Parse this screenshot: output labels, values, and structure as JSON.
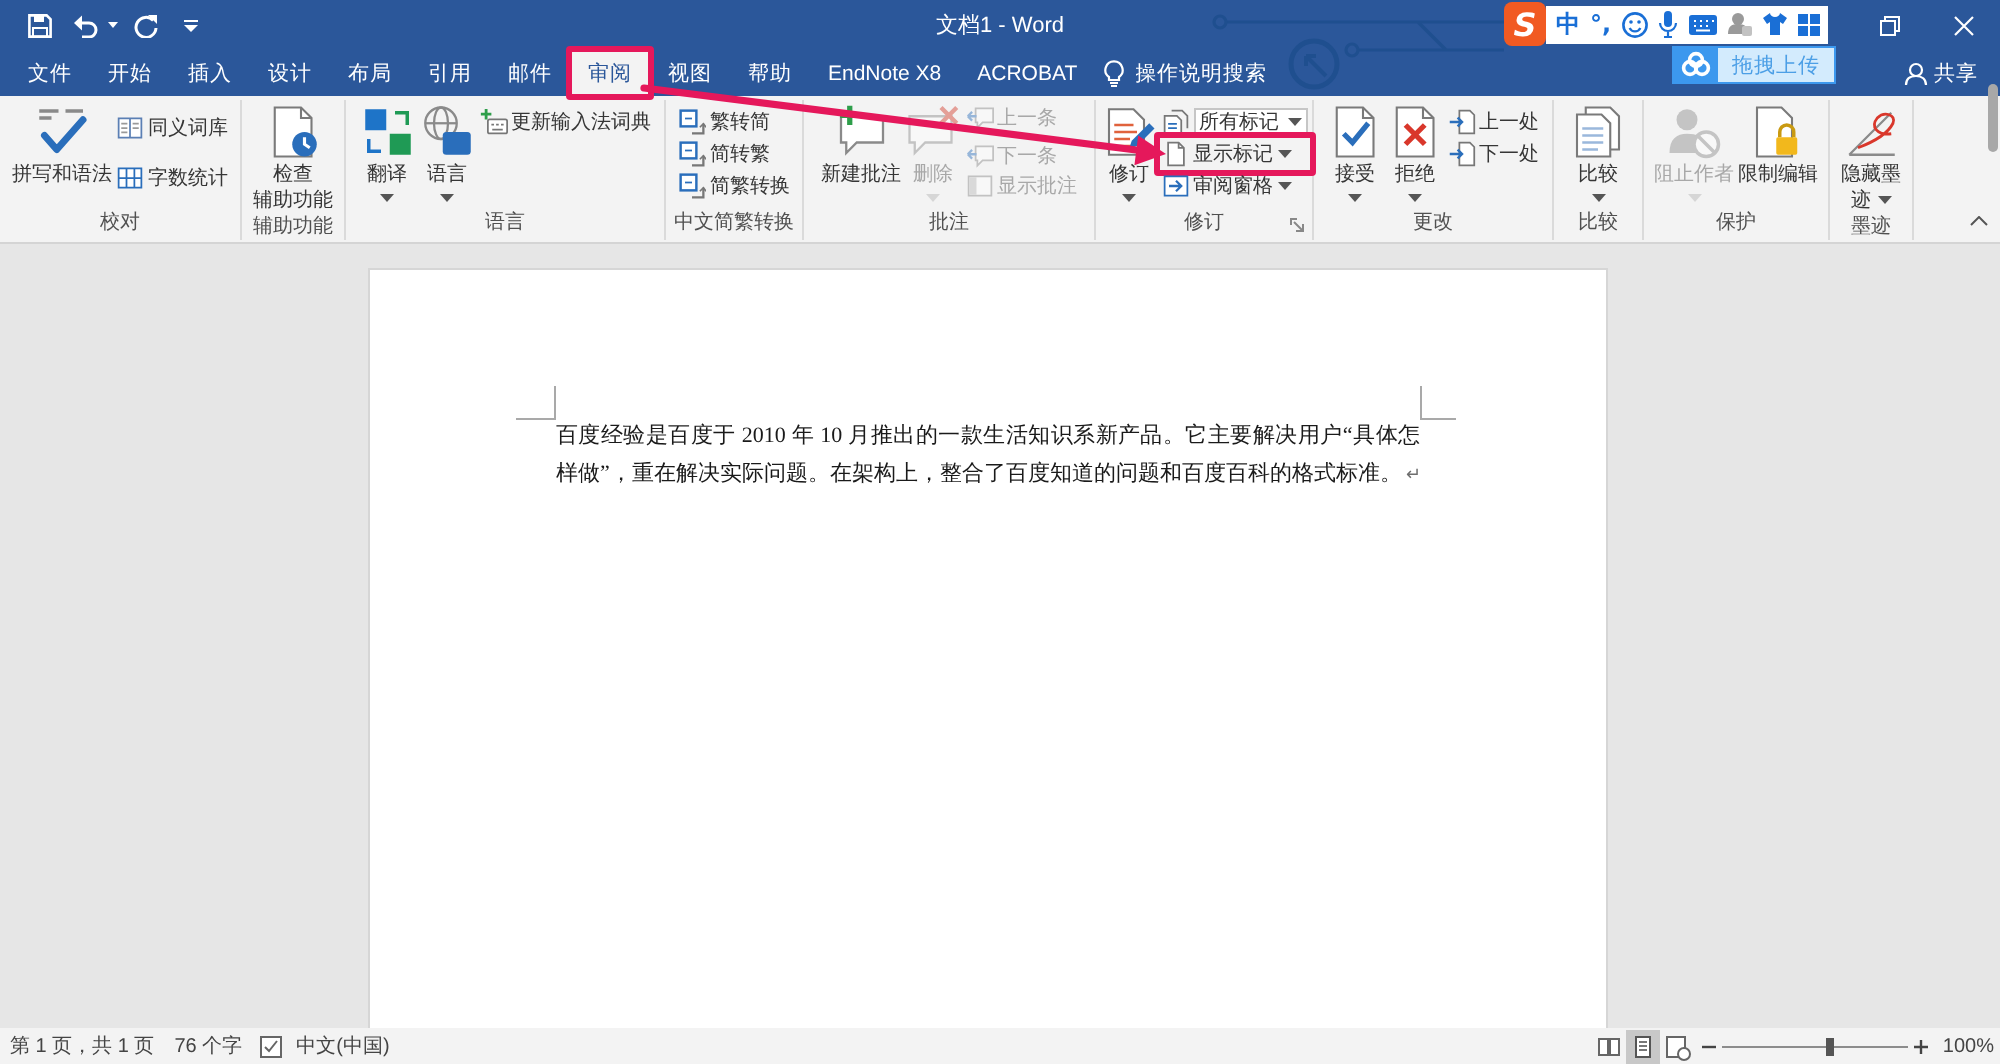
{
  "window": {
    "title": "文档1 - Word"
  },
  "ime_toolbar": {
    "logo": "S",
    "mode": "中",
    "punctuation": "°,"
  },
  "cloud_upload": {
    "label": "拖拽上传"
  },
  "tabs": [
    {
      "label": "文件",
      "selected": false,
      "highlighted": false
    },
    {
      "label": "开始",
      "selected": false,
      "highlighted": false
    },
    {
      "label": "插入",
      "selected": false,
      "highlighted": false
    },
    {
      "label": "设计",
      "selected": false,
      "highlighted": false
    },
    {
      "label": "布局",
      "selected": false,
      "highlighted": false
    },
    {
      "label": "引用",
      "selected": false,
      "highlighted": false
    },
    {
      "label": "邮件",
      "selected": false,
      "highlighted": false
    },
    {
      "label": "审阅",
      "selected": true,
      "highlighted": true
    },
    {
      "label": "视图",
      "selected": false,
      "highlighted": false
    },
    {
      "label": "帮助",
      "selected": false,
      "highlighted": false
    },
    {
      "label": "EndNote X8",
      "selected": false,
      "highlighted": false
    },
    {
      "label": "ACROBAT",
      "selected": false,
      "highlighted": false
    }
  ],
  "search": {
    "placeholder": "操作说明搜索"
  },
  "share": {
    "label": "共享"
  },
  "ribbon": {
    "groups": [
      {
        "label": "校对",
        "launcher": false,
        "items": [
          {
            "kind": "large",
            "label": "拼写和语法",
            "disabled": false,
            "has_menu": false,
            "highlighted": false
          },
          {
            "kind": "small",
            "label": "同义词库",
            "disabled": false,
            "has_menu": false,
            "highlighted": false
          },
          {
            "kind": "small",
            "label": "字数统计",
            "disabled": false,
            "has_menu": false,
            "highlighted": false
          }
        ]
      },
      {
        "label": "辅助功能",
        "launcher": false,
        "items": [
          {
            "kind": "large",
            "label": "检查辅助功能",
            "disabled": false,
            "has_menu": false,
            "highlighted": false
          }
        ]
      },
      {
        "label": "语言",
        "launcher": false,
        "items": [
          {
            "kind": "large",
            "label": "翻译",
            "disabled": false,
            "has_menu": true,
            "highlighted": false
          },
          {
            "kind": "large",
            "label": "语言",
            "disabled": false,
            "has_menu": true,
            "highlighted": false
          },
          {
            "kind": "small",
            "label": "更新输入法词典",
            "disabled": false,
            "has_menu": false,
            "highlighted": false
          }
        ]
      },
      {
        "label": "中文简繁转换",
        "launcher": false,
        "items": [
          {
            "kind": "small",
            "label": "繁转简",
            "disabled": false,
            "has_menu": false,
            "highlighted": false
          },
          {
            "kind": "small",
            "label": "简转繁",
            "disabled": false,
            "has_menu": false,
            "highlighted": false
          },
          {
            "kind": "small",
            "label": "简繁转换",
            "disabled": false,
            "has_menu": false,
            "highlighted": false
          }
        ]
      },
      {
        "label": "批注",
        "launcher": false,
        "items": [
          {
            "kind": "large",
            "label": "新建批注",
            "disabled": false,
            "has_menu": false,
            "highlighted": false
          },
          {
            "kind": "large",
            "label": "删除",
            "disabled": true,
            "has_menu": true,
            "highlighted": false
          },
          {
            "kind": "small",
            "label": "上一条",
            "disabled": true,
            "has_menu": false,
            "highlighted": false
          },
          {
            "kind": "small",
            "label": "下一条",
            "disabled": true,
            "has_menu": false,
            "highlighted": false
          },
          {
            "kind": "small",
            "label": "显示批注",
            "disabled": true,
            "has_menu": false,
            "highlighted": false
          }
        ]
      },
      {
        "label": "修订",
        "launcher": true,
        "items": [
          {
            "kind": "large",
            "label": "修订",
            "disabled": false,
            "has_menu": true,
            "highlighted": false
          },
          {
            "kind": "combo",
            "label": "所有标记",
            "disabled": false,
            "has_menu": true,
            "highlighted": false
          },
          {
            "kind": "small",
            "label": "显示标记",
            "disabled": false,
            "has_menu": true,
            "highlighted": true
          },
          {
            "kind": "small",
            "label": "审阅窗格",
            "disabled": false,
            "has_menu": true,
            "highlighted": false
          }
        ]
      },
      {
        "label": "更改",
        "launcher": false,
        "items": [
          {
            "kind": "large",
            "label": "接受",
            "disabled": false,
            "has_menu": true,
            "highlighted": false
          },
          {
            "kind": "large",
            "label": "拒绝",
            "disabled": false,
            "has_menu": true,
            "highlighted": false
          },
          {
            "kind": "small",
            "label": "上一处",
            "disabled": false,
            "has_menu": false,
            "highlighted": false
          },
          {
            "kind": "small",
            "label": "下一处",
            "disabled": false,
            "has_menu": false,
            "highlighted": false
          }
        ]
      },
      {
        "label": "比较",
        "launcher": false,
        "items": [
          {
            "kind": "large",
            "label": "比较",
            "disabled": false,
            "has_menu": true,
            "highlighted": false
          }
        ]
      },
      {
        "label": "保护",
        "launcher": false,
        "items": [
          {
            "kind": "large",
            "label": "阻止作者",
            "disabled": true,
            "has_menu": true,
            "highlighted": false
          },
          {
            "kind": "large",
            "label": "限制编辑",
            "disabled": false,
            "has_menu": false,
            "highlighted": false
          }
        ]
      },
      {
        "label": "墨迹",
        "launcher": false,
        "items": [
          {
            "kind": "large",
            "label": "隐藏墨迹",
            "disabled": false,
            "has_menu": true,
            "highlighted": false
          }
        ]
      }
    ]
  },
  "annotation_arrow": true,
  "document": {
    "paragraph": "百度经验是百度于 2010 年 10 月推出的一款生活知识系新产品。它主要解决用户“具体怎样做”，重在解决实际问题。在架构上，整合了百度知道的问题和百度百科的格式标准。",
    "paragraph_mark": "↵"
  },
  "status_bar": {
    "page": "第 1 页，共 1 页",
    "words": "76 个字",
    "language": "中文(中国)",
    "views": [
      {
        "selected": false
      },
      {
        "selected": true
      },
      {
        "selected": false
      }
    ],
    "zoom": {
      "level": 0.58,
      "reading": "100%"
    }
  }
}
